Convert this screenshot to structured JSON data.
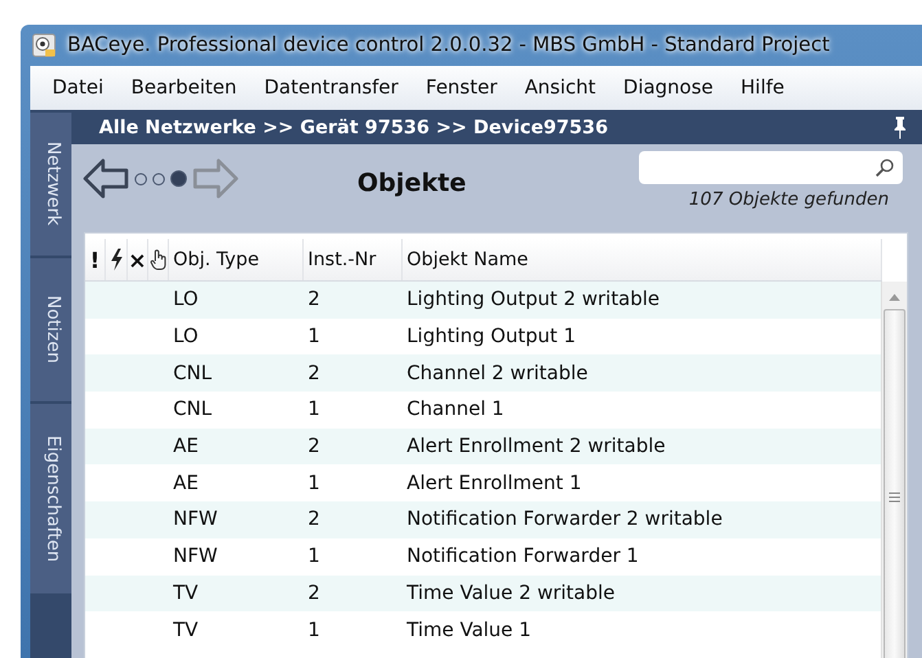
{
  "window": {
    "title": "BACeye. Professional device control 2.0.0.32 - MBS GmbH - Standard Project"
  },
  "menu": [
    "Datei",
    "Bearbeiten",
    "Datentransfer",
    "Fenster",
    "Ansicht",
    "Diagnose",
    "Hilfe"
  ],
  "side_tabs": [
    "Netzwerk",
    "Notizen",
    "Eigenschaften"
  ],
  "breadcrumb": "Alle Netzwerke >> Gerät 97536 >> Device97536",
  "nav": {
    "back": {
      "disabled": false
    },
    "forward": {
      "disabled": true
    },
    "page_dots": [
      {
        "selected": false
      },
      {
        "selected": false
      },
      {
        "selected": true
      }
    ]
  },
  "heading": "Objekte",
  "search": {
    "result_count": "107 Objekte gefunden"
  },
  "table": {
    "columns": [
      {
        "kind": "text",
        "label": "!"
      },
      {
        "kind": "bolt"
      },
      {
        "kind": "text",
        "label": "×"
      },
      {
        "kind": "hand"
      },
      {
        "kind": "text",
        "label": "Obj. Type"
      },
      {
        "kind": "text",
        "label": "Inst.-Nr"
      },
      {
        "kind": "text",
        "label": "Objekt Name"
      }
    ],
    "rows": [
      {
        "type": "LO",
        "instance": "2",
        "name": "Lighting Output 2 writable"
      },
      {
        "type": "LO",
        "instance": "1",
        "name": "Lighting Output 1"
      },
      {
        "type": "CNL",
        "instance": "2",
        "name": "Channel 2 writable"
      },
      {
        "type": "CNL",
        "instance": "1",
        "name": "Channel 1"
      },
      {
        "type": "AE",
        "instance": "2",
        "name": "Alert Enrollment 2 writable"
      },
      {
        "type": "AE",
        "instance": "1",
        "name": "Alert Enrollment 1"
      },
      {
        "type": "NFW",
        "instance": "2",
        "name": "Notification Forwarder 2 writable"
      },
      {
        "type": "NFW",
        "instance": "1",
        "name": "Notification Forwarder 1"
      },
      {
        "type": "TV",
        "instance": "2",
        "name": "Time Value 2 writable"
      },
      {
        "type": "TV",
        "instance": "1",
        "name": "Time Value 1"
      }
    ]
  }
}
